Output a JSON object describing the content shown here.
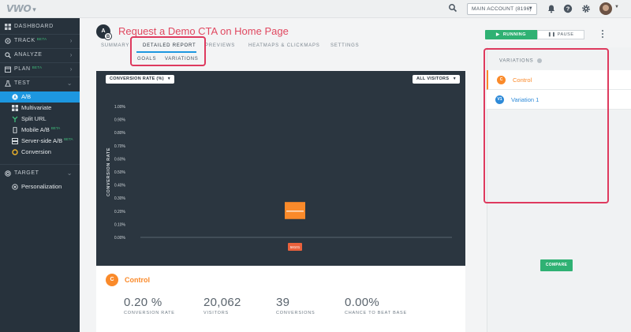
{
  "topbar": {
    "logo": "VWO",
    "account_label": "MAIN ACCOUNT (8196)",
    "icons": [
      "search-icon",
      "bell-icon",
      "help-icon",
      "settings-icon",
      "user-avatar"
    ]
  },
  "sidebar": {
    "items": [
      {
        "label": "DASHBOARD",
        "icon": "dashboard-icon"
      },
      {
        "label": "TRACK",
        "badge": "BETA",
        "icon": "track-icon"
      },
      {
        "label": "ANALYZE",
        "icon": "analyze-icon"
      },
      {
        "label": "PLAN",
        "badge": "BETA",
        "icon": "plan-icon"
      },
      {
        "label": "TEST",
        "icon": "test-icon"
      }
    ],
    "test_subitems": [
      {
        "label": "A/B",
        "icon": "ab-icon"
      },
      {
        "label": "Multivariate",
        "icon": "multivariate-icon"
      },
      {
        "label": "Split URL",
        "icon": "split-url-icon"
      },
      {
        "label": "Mobile A/B",
        "badge": "BETA",
        "icon": "mobile-icon"
      },
      {
        "label": "Server-side A/B",
        "badge": "BETA",
        "icon": "server-icon"
      },
      {
        "label": "Conversion",
        "icon": "conversion-icon"
      }
    ],
    "target": {
      "label": "TARGET",
      "icon": "target-icon"
    },
    "target_subitems": [
      {
        "label": "Personalization",
        "icon": "personalization-icon"
      }
    ]
  },
  "header": {
    "badge": "A",
    "badge_secondary": "B",
    "title": "Request a Demo CTA on Home Page",
    "tabs": [
      "SUMMARY",
      "DETAILED REPORT",
      "PREVIEWS",
      "HEATMAPS & CLICKMAPS",
      "SETTINGS"
    ],
    "active_tab": "DETAILED REPORT",
    "subtabs": [
      "GOALS",
      "VARIATIONS"
    ],
    "running_label": "RUNNING",
    "pause_label": "PAUSE"
  },
  "chart_controls": {
    "metric_dropdown": "CONVERSION RATE (%)",
    "segment_dropdown": "ALL VISITORS"
  },
  "chart_data": {
    "type": "box",
    "title": "",
    "xlabel": "",
    "ylabel": "CONVERSION RATE",
    "ytick_labels": [
      "1.00%",
      "0.90%",
      "0.80%",
      "0.70%",
      "0.60%",
      "0.50%",
      "0.40%",
      "0.30%",
      "0.20%",
      "0.10%",
      "0.00%"
    ],
    "ylim": [
      0,
      1.0
    ],
    "categories": [
      "58101"
    ],
    "series": [
      {
        "name": "Control",
        "color": "#fa8a2a",
        "low": 0.14,
        "median": 0.2,
        "high": 0.27
      }
    ],
    "grid": false
  },
  "result_card": {
    "badge": "C",
    "title": "Control",
    "metrics": [
      {
        "value": "0.20 %",
        "label": "CONVERSION RATE"
      },
      {
        "value": "20,062",
        "label": "VISITORS"
      },
      {
        "value": "39",
        "label": "CONVERSIONS"
      },
      {
        "value": "0.00%",
        "label": "CHANCE TO BEAT BASE"
      }
    ]
  },
  "variations_panel": {
    "heading": "VARIATIONS",
    "items": [
      {
        "badge": "C",
        "name": "Control",
        "color": "#fa8a2a"
      },
      {
        "badge": "V1",
        "name": "Variation 1",
        "color": "#2e8ad8"
      }
    ],
    "compare_label": "COMPARE"
  }
}
